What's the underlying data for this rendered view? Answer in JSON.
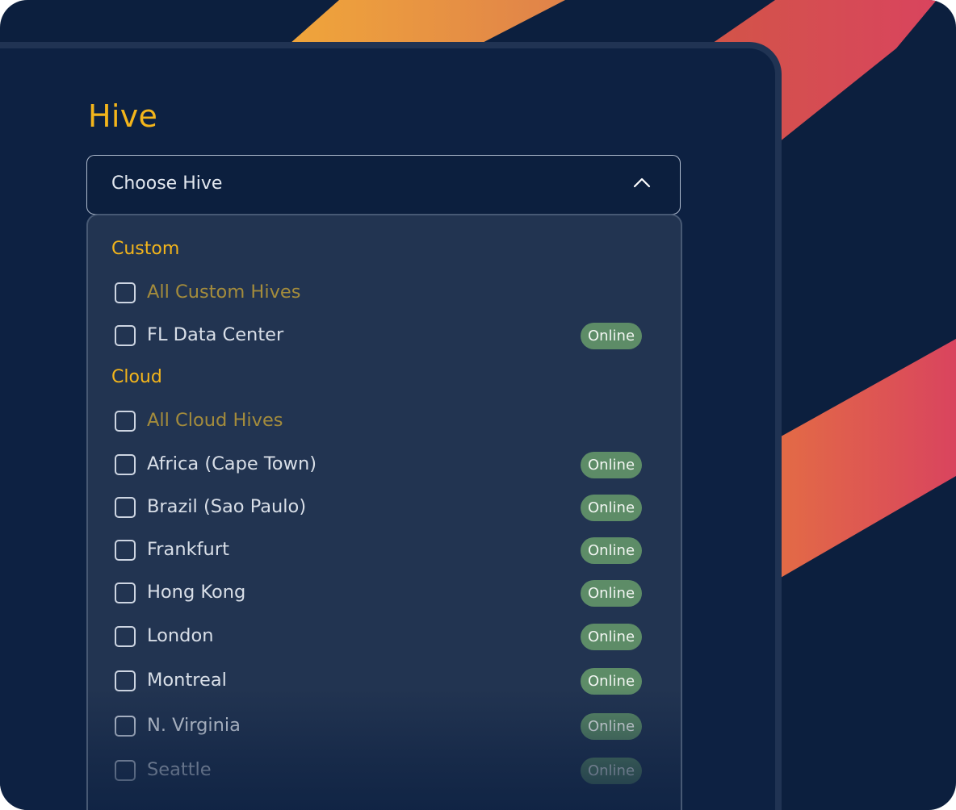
{
  "hive": {
    "title": "Hive",
    "select_placeholder": "Choose Hive"
  },
  "dropdown": {
    "groups": [
      {
        "label": "Custom",
        "options": [
          {
            "label": "All Custom Hives",
            "status": ""
          },
          {
            "label": "FL Data Center",
            "status": "Online"
          }
        ]
      },
      {
        "label": "Cloud",
        "options": [
          {
            "label": "All Cloud Hives",
            "status": ""
          },
          {
            "label": "Africa (Cape Town)",
            "status": "Online"
          },
          {
            "label": "Brazil (Sao Paulo)",
            "status": "Online"
          },
          {
            "label": "Frankfurt",
            "status": "Online"
          },
          {
            "label": "Hong Kong",
            "status": "Online"
          },
          {
            "label": "London",
            "status": "Online"
          },
          {
            "label": "Montreal",
            "status": "Online"
          },
          {
            "label": "N. Virginia",
            "status": "Online"
          },
          {
            "label": "Seattle",
            "status": "Online"
          }
        ]
      }
    ]
  },
  "colors": {
    "background": "#0c1f3e",
    "accent": "#f3b51b",
    "online_badge": "#5d8c67",
    "stripe_start": "#f0a63a",
    "stripe_end": "#d9445e"
  },
  "icons": {
    "select_toggle": "chevron-up-icon",
    "option_checkbox": "checkbox-icon"
  }
}
